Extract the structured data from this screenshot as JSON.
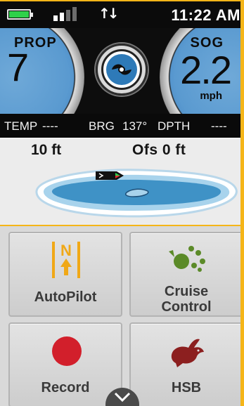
{
  "status_bar": {
    "time": "11:22 AM",
    "battery_level": 1.0,
    "signal_bars_active": 2,
    "signal_bars_total": 4,
    "data_icon": "data-transfer-arrows-icon",
    "colors": {
      "battery": "#2fd14a",
      "background": "#0b0b0b"
    }
  },
  "gauges": {
    "left": {
      "label": "PROP",
      "value": "7"
    },
    "right": {
      "label": "SOG",
      "value": "2.2",
      "unit": "mph"
    },
    "center_button_icon": "propeller-icon"
  },
  "info_strip": {
    "temp_label": "TEMP",
    "temp_value": "----",
    "brg_label": "BRG",
    "brg_value": "137°",
    "depth_label": "DPTH",
    "depth_value": "----"
  },
  "map_panel": {
    "depth": "10 ft",
    "offset": "Ofs 0 ft",
    "boat_icon": "boat-icon",
    "colors": {
      "water": "#3f92c6",
      "shore": "#bfe1f2"
    }
  },
  "tiles": [
    {
      "label": "AutoPilot",
      "icon": "north-arrow-icon"
    },
    {
      "label": "Cruise",
      "label2": "Control",
      "icon": "cruise-control-icon"
    },
    {
      "label": "Record",
      "icon": "record-dot-icon"
    },
    {
      "label": "HSB",
      "icon": "rabbit-icon"
    }
  ],
  "accent_color": "#f5b518",
  "expand_icon": "chevron-down-icon"
}
